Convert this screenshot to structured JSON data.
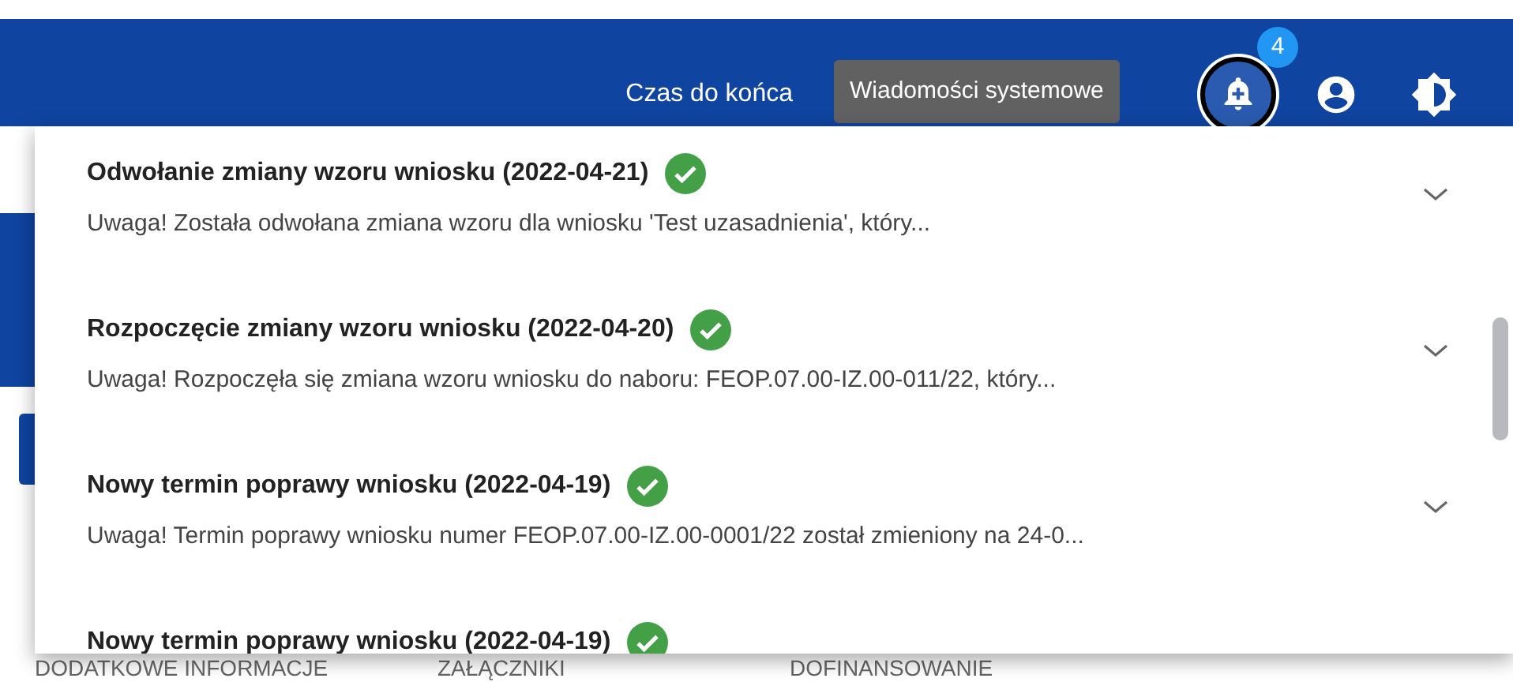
{
  "header": {
    "timer_label": "Czas do końca",
    "tooltip": "Wiadomości systemowe",
    "notification_count": "4"
  },
  "background_tabs": [
    "DODATKOWE INFORMACJE",
    "ZAŁĄCZNIKI",
    "DOFINANSOWANIE"
  ],
  "messages": [
    {
      "title": "Odwołanie zmiany wzoru wniosku (2022-04-21)",
      "text": "Uwaga! Została odwołana zmiana wzoru dla wniosku 'Test uzasadnienia', który...",
      "expanded": false
    },
    {
      "title": "Rozpoczęcie zmiany wzoru wniosku (2022-04-20)",
      "text": "Uwaga! Rozpoczęła się zmiana wzoru wniosku do naboru: FEOP.07.00-IZ.00-011/22, który...",
      "expanded": false
    },
    {
      "title": "Nowy termin poprawy wniosku (2022-04-19)",
      "text": "Uwaga! Termin poprawy wniosku numer FEOP.07.00-IZ.00-0001/22 został zmieniony na 24-0...",
      "expanded": false
    },
    {
      "title": "Nowy termin poprawy wniosku (2022-04-19)"
    }
  ]
}
